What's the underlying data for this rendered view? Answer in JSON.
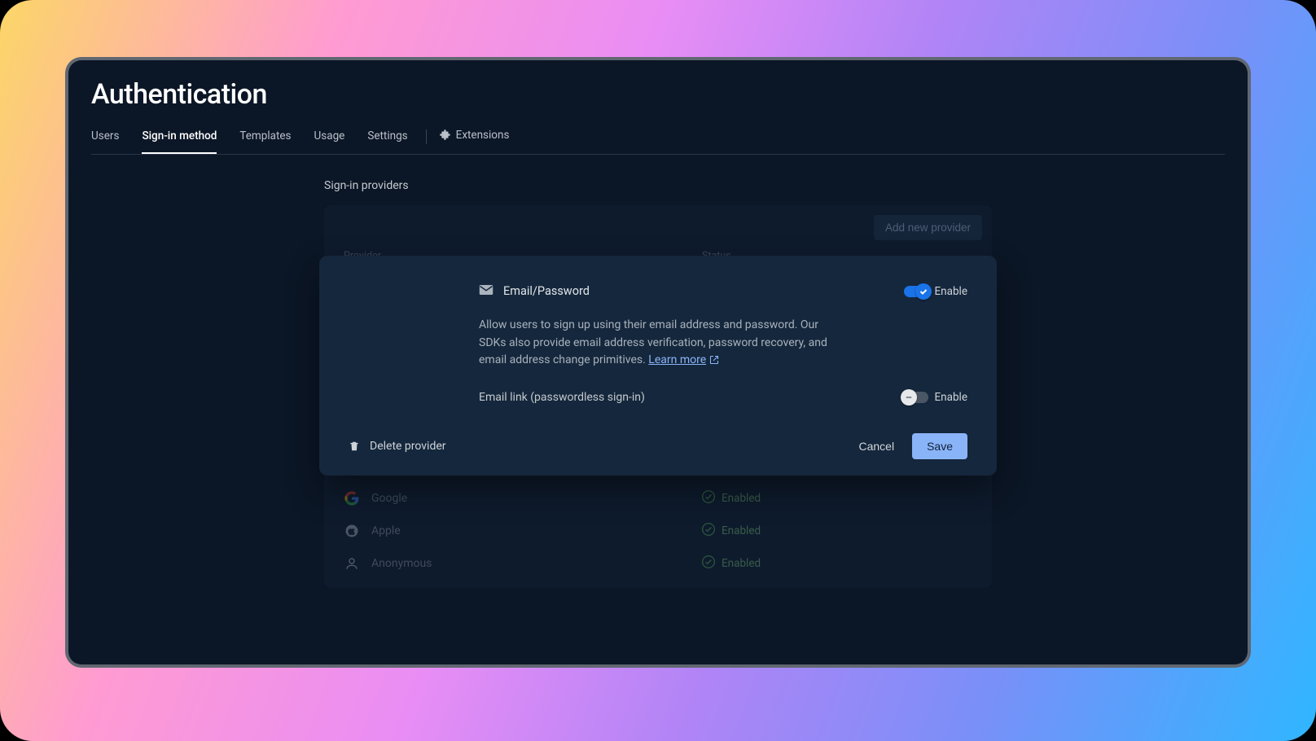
{
  "page": {
    "title": "Authentication",
    "tabs": [
      "Users",
      "Sign-in method",
      "Templates",
      "Usage",
      "Settings"
    ],
    "active_tab": "Sign-in method",
    "extensions_label": "Extensions"
  },
  "section": {
    "label": "Sign-in providers",
    "add_button": "Add new provider",
    "columns": {
      "provider": "Provider",
      "status": "Status"
    }
  },
  "providers": [
    {
      "icon": "google",
      "name": "Google",
      "status": "Enabled"
    },
    {
      "icon": "apple",
      "name": "Apple",
      "status": "Enabled"
    },
    {
      "icon": "person",
      "name": "Anonymous",
      "status": "Enabled"
    }
  ],
  "modal": {
    "provider_icon": "mail",
    "provider_name": "Email/Password",
    "enable1": {
      "label": "Enable",
      "on": true
    },
    "description": "Allow users to sign up using their email address and password. Our SDKs also provide email address verification, password recovery, and email address change primitives. ",
    "learn_more": "Learn more",
    "secondary_label": "Email link (passwordless sign-in)",
    "enable2": {
      "label": "Enable",
      "on": false
    },
    "delete": "Delete provider",
    "cancel": "Cancel",
    "save": "Save"
  },
  "colors": {
    "accent": "#8ab4f8",
    "toggle_on": "#1a73e8",
    "status_ok": "#54a054"
  }
}
